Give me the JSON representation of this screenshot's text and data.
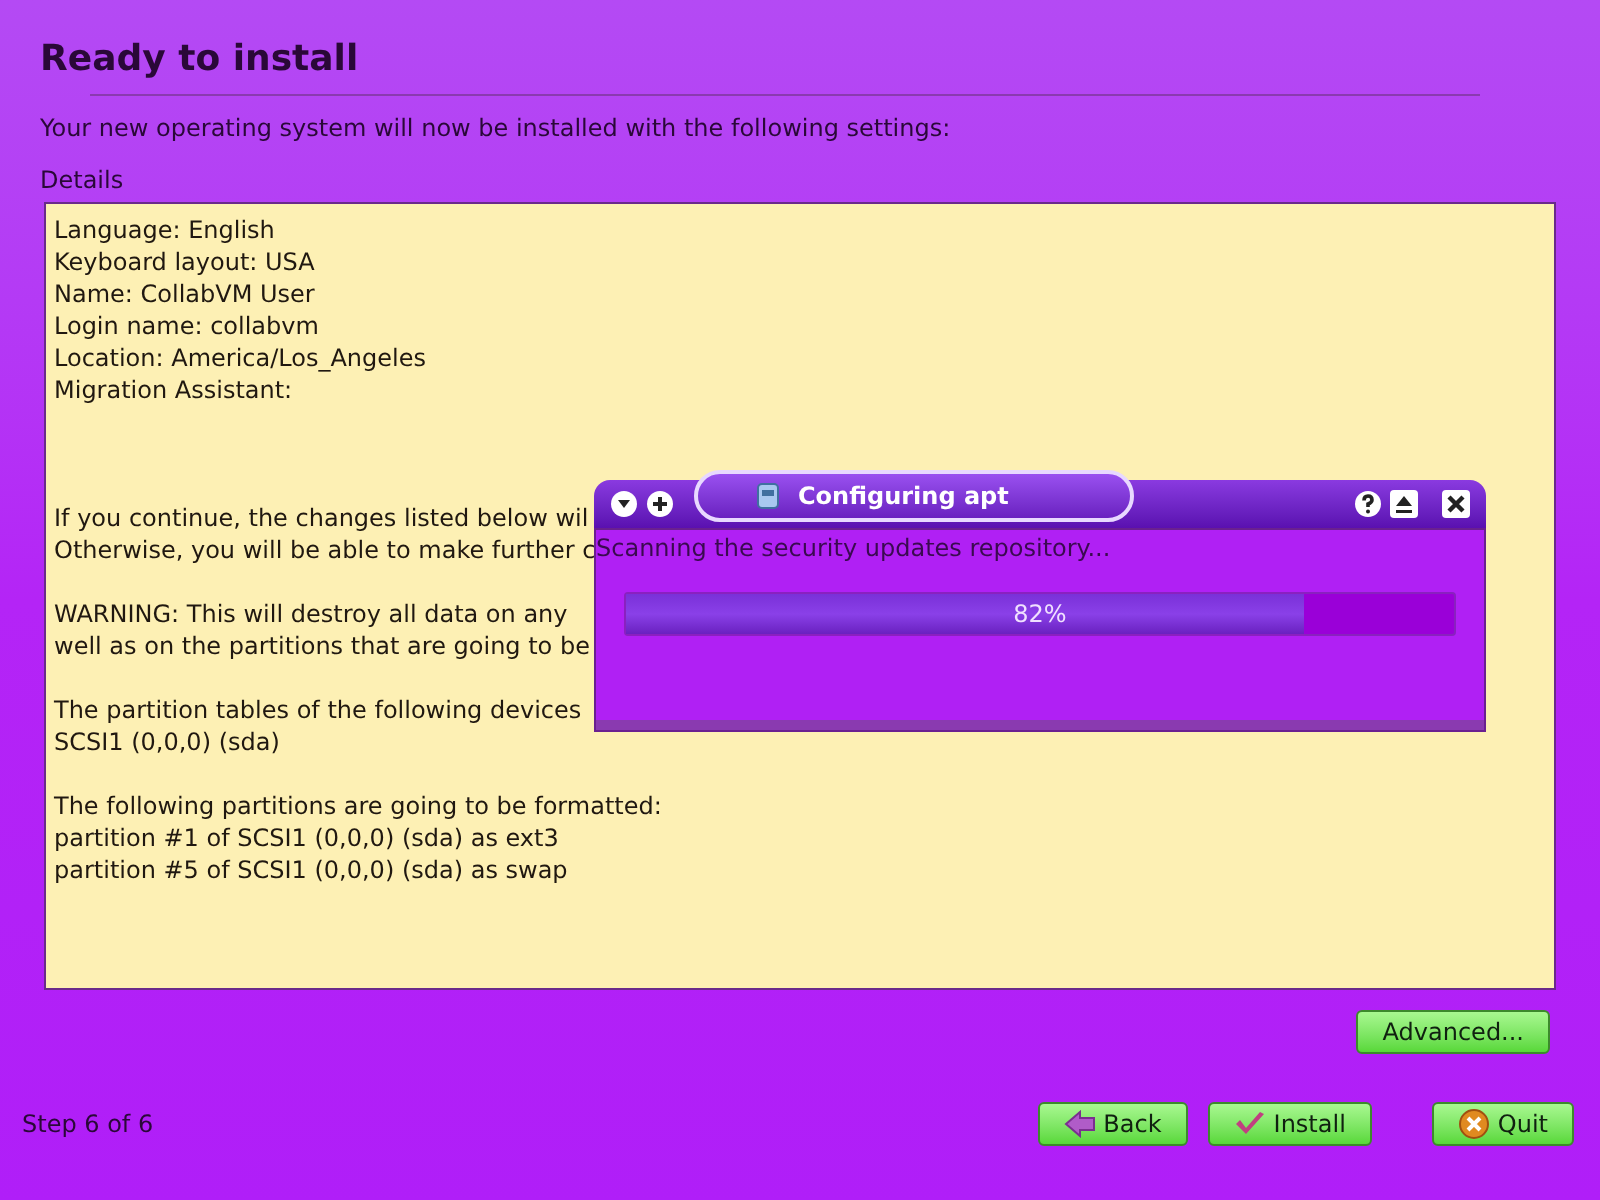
{
  "page": {
    "title": "Ready to install",
    "subtitle": "Your new operating system will now be installed with the following settings:",
    "details_label": "Details"
  },
  "details": [
    {
      "kind": "line",
      "text": "Language: English"
    },
    {
      "kind": "line",
      "text": "Keyboard layout: USA"
    },
    {
      "kind": "line",
      "text": "Name: CollabVM User"
    },
    {
      "kind": "line",
      "text": "Login name: collabvm"
    },
    {
      "kind": "line",
      "text": "Location: America/Los_Angeles"
    },
    {
      "kind": "line",
      "text": "Migration Assistant:"
    },
    {
      "kind": "blank"
    },
    {
      "kind": "blank"
    },
    {
      "kind": "blank"
    },
    {
      "kind": "line",
      "text": "If you continue, the changes listed below wil"
    },
    {
      "kind": "line",
      "text": "Otherwise, you will be able to make further c"
    },
    {
      "kind": "blank"
    },
    {
      "kind": "line",
      "text": "WARNING: This will destroy all data on any"
    },
    {
      "kind": "line",
      "text": "well as on the partitions that are going to be"
    },
    {
      "kind": "blank"
    },
    {
      "kind": "line",
      "text": "The partition tables of the following devices"
    },
    {
      "kind": "line",
      "text": "SCSI1 (0,0,0) (sda)"
    },
    {
      "kind": "blank"
    },
    {
      "kind": "line",
      "text": "The following partitions are going to be formatted:"
    },
    {
      "kind": "line",
      "text": "partition #1 of SCSI1 (0,0,0) (sda) as ext3"
    },
    {
      "kind": "line",
      "text": "partition #5 of SCSI1 (0,0,0) (sda) as swap"
    }
  ],
  "advanced_button": "Advanced...",
  "status": "Step 6 of 6",
  "buttons": [
    {
      "kind": "back",
      "label": "Back"
    },
    {
      "kind": "install",
      "label": "Install"
    },
    {
      "kind": "quit",
      "label": "Quit"
    }
  ],
  "dialog": {
    "title": "Configuring apt",
    "message": "Scanning the security updates repository...",
    "progress": {
      "level": 0.82,
      "reading": "82%"
    }
  }
}
